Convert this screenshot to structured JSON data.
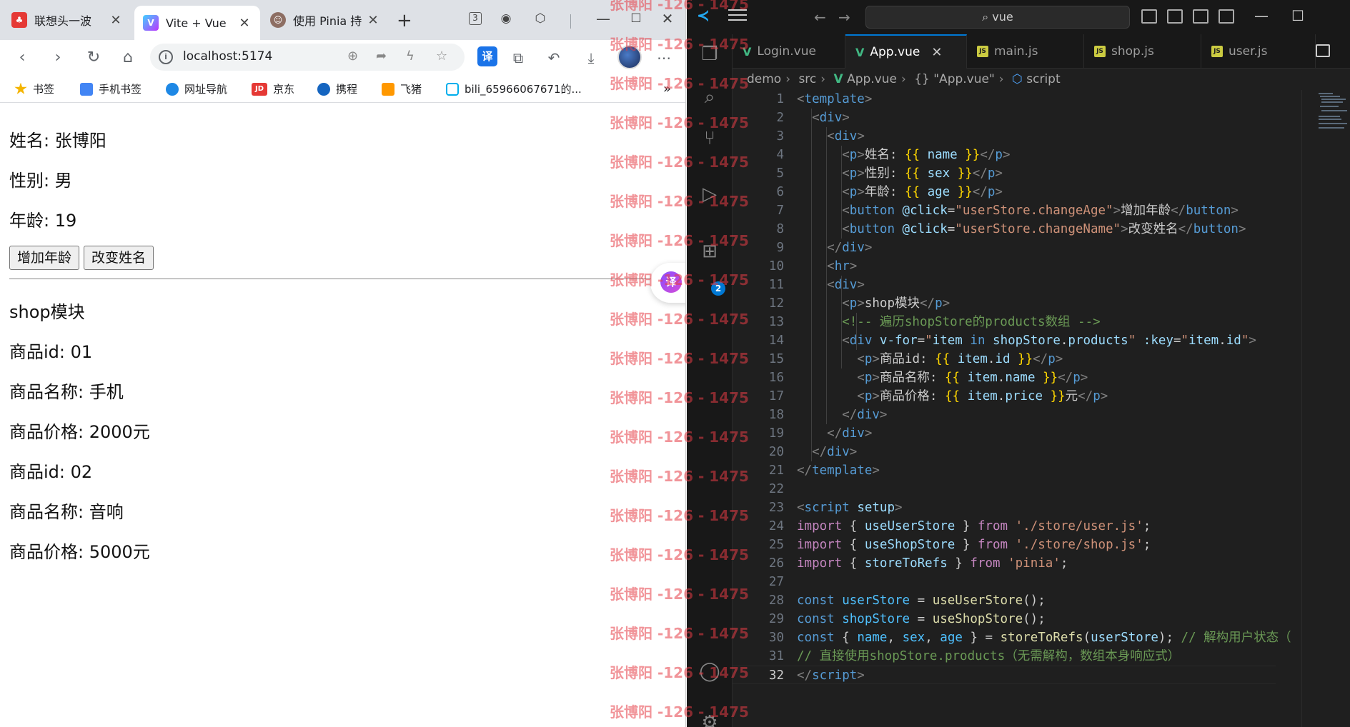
{
  "browser": {
    "tabs": [
      {
        "title": "联想头一波",
        "fav": "♣",
        "fav_color": "#e53935"
      },
      {
        "title": "Vite + Vue",
        "fav": "V",
        "fav_color": "#7e57c2"
      },
      {
        "title": "使用 Pinia 持久",
        "fav": "☺",
        "fav_color": "#8d6e63"
      }
    ],
    "url": "localhost:5174",
    "translate_label": "译",
    "bookmarks": [
      {
        "label": "书签",
        "color": "#f4b400"
      },
      {
        "label": "手机书签",
        "color": "#4285f4"
      },
      {
        "label": "网址导航",
        "color": "#1e88e5"
      },
      {
        "label": "京东",
        "color": "#e53935"
      },
      {
        "label": "携程",
        "color": "#1565c0"
      },
      {
        "label": "飞猪",
        "color": "#ff9800"
      },
      {
        "label": "bili_65966067671的...",
        "color": "#00aeec"
      }
    ],
    "bookmarks_more": "»",
    "page": {
      "name_line": "姓名: 张博阳",
      "sex_line": "性别: 男",
      "age_line": "年龄: 19",
      "btn_add_age": "增加年龄",
      "btn_change_name": "改变姓名",
      "shop_title": "shop模块",
      "products": [
        {
          "id": "商品id: 01",
          "name": "商品名称: 手机",
          "price": "商品价格: 2000元"
        },
        {
          "id": "商品id: 02",
          "name": "商品名称: 音响",
          "price": "商品价格: 5000元"
        }
      ],
      "float_translate": "译"
    }
  },
  "vscode": {
    "search": "vue",
    "badge": "2",
    "tabs": [
      {
        "label": "Login.vue",
        "type": "vue"
      },
      {
        "label": "App.vue",
        "type": "vue"
      },
      {
        "label": "main.js",
        "type": "js"
      },
      {
        "label": "shop.js",
        "type": "js"
      },
      {
        "label": "user.js",
        "type": "js"
      }
    ],
    "breadcrumbs": [
      "demo",
      "src",
      "App.vue",
      "{} \"App.vue\"",
      "script"
    ],
    "current_line": "32",
    "lines": [
      "1",
      "2",
      "3",
      "4",
      "5",
      "6",
      "7",
      "8",
      "9",
      "10",
      "11",
      "12",
      "13",
      "14",
      "15",
      "16",
      "17",
      "18",
      "19",
      "20",
      "21",
      "22",
      "23",
      "24",
      "25",
      "26",
      "27",
      "28",
      "29",
      "30",
      "31",
      "32"
    ]
  },
  "watermark": "张博阳 -126 - 1475",
  "colors": {
    "accent": "#0078d4",
    "vue": "#41b883",
    "watermark": "#e63c46"
  }
}
